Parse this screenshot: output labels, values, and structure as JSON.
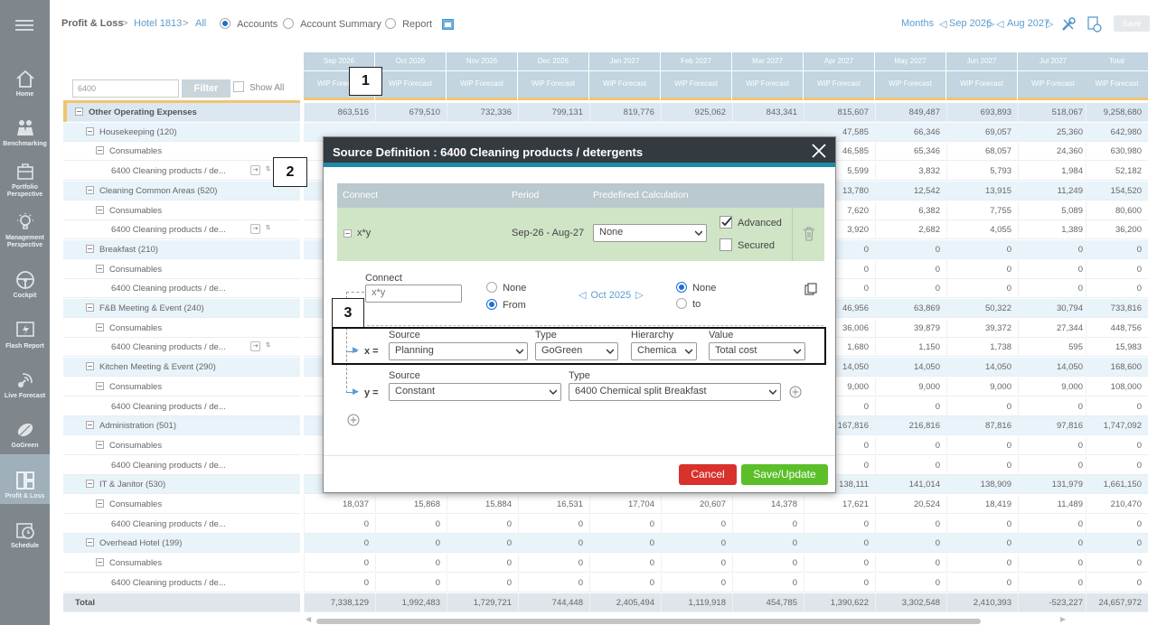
{
  "topbar": {
    "profit_loss": "Profit & Loss",
    "hotel": "Hotel 1813",
    "all": "All",
    "view_options": [
      "Accounts",
      "Account Summary",
      "Report"
    ],
    "months": "Months",
    "from_month": "Sep 2026",
    "to_month": "Aug 2027",
    "save": "Save"
  },
  "sidebar": {
    "items": [
      {
        "label": "Home",
        "icon": "home-icon"
      },
      {
        "label": "Benchmarking",
        "icon": "people-icon"
      },
      {
        "label": "Portfolio Perspective",
        "icon": "portfolio-icon"
      },
      {
        "label": "Management Perspective",
        "icon": "bulb-icon"
      },
      {
        "label": "Cockpit",
        "icon": "steering-wheel-icon"
      },
      {
        "label": "Flash Report",
        "icon": "flash-icon"
      },
      {
        "label": "Live Forecast",
        "icon": "satellite-icon"
      },
      {
        "label": "GoGreen",
        "icon": "leaf-icon"
      },
      {
        "label": "Profit & Loss",
        "icon": "grid-icon"
      },
      {
        "label": "Schedule",
        "icon": "clock-icon"
      }
    ]
  },
  "filter": {
    "value": "6400",
    "button": "Filter",
    "show_all": "Show All"
  },
  "grid": {
    "months": [
      "Sep 2026",
      "Oct 2026",
      "Nov 2026",
      "Dec 2026",
      "Jan 2027",
      "Feb 2027",
      "Mar 2027",
      "Apr 2027",
      "May 2027",
      "Jun 2027",
      "Jul 2027"
    ],
    "total_header": "Total",
    "sub_header": "WiP Forecast",
    "rows": [
      {
        "label": "Other Operating Expenses",
        "level": 0,
        "style": "sel",
        "tools": false,
        "vals": [
          "863,516",
          "679,510",
          "732,336",
          "799,131",
          "819,776",
          "925,062",
          "843,341",
          "815,607",
          "849,487",
          "693,893",
          "518,067"
        ],
        "total": "9,258,680"
      },
      {
        "label": "Housekeeping (120)",
        "level": 1,
        "style": "band",
        "tools": false,
        "vals": [
          "",
          "",
          "",
          "",
          "",
          "",
          "",
          "47,585",
          "66,346",
          "69,057",
          "25,360"
        ],
        "total": "642,980"
      },
      {
        "label": "Consumables",
        "level": 2,
        "style": "",
        "tools": false,
        "vals": [
          "",
          "",
          "",
          "",
          "",
          "",
          "",
          "46,585",
          "65,346",
          "68,057",
          "24,360"
        ],
        "total": "630,980"
      },
      {
        "label": "6400 Cleaning products / de...",
        "level": 3,
        "style": "",
        "tools": true,
        "vals": [
          "",
          "",
          "",
          "",
          "",
          "",
          "",
          "5,599",
          "3,832",
          "5,793",
          "1,984"
        ],
        "total": "52,182"
      },
      {
        "label": "Cleaning Common Areas (520)",
        "level": 1,
        "style": "band",
        "tools": false,
        "vals": [
          "",
          "",
          "",
          "",
          "",
          "",
          "",
          "13,780",
          "12,542",
          "13,915",
          "11,249"
        ],
        "total": "154,520"
      },
      {
        "label": "Consumables",
        "level": 2,
        "style": "",
        "tools": false,
        "vals": [
          "",
          "",
          "",
          "",
          "",
          "",
          "",
          "7,620",
          "6,382",
          "7,755",
          "5,089"
        ],
        "total": "80,600"
      },
      {
        "label": "6400 Cleaning products / de...",
        "level": 3,
        "style": "",
        "tools": true,
        "vals": [
          "",
          "",
          "",
          "",
          "",
          "",
          "",
          "3,920",
          "2,682",
          "4,055",
          "1,389"
        ],
        "total": "36,200"
      },
      {
        "label": "Breakfast (210)",
        "level": 1,
        "style": "band",
        "tools": false,
        "vals": [
          "",
          "",
          "",
          "",
          "",
          "",
          "",
          "0",
          "0",
          "0",
          "0"
        ],
        "total": "0"
      },
      {
        "label": "Consumables",
        "level": 2,
        "style": "",
        "tools": false,
        "vals": [
          "",
          "",
          "",
          "",
          "",
          "",
          "",
          "0",
          "0",
          "0",
          "0"
        ],
        "total": "0"
      },
      {
        "label": "6400 Cleaning products / de...",
        "level": 3,
        "style": "",
        "tools": false,
        "vals": [
          "",
          "",
          "",
          "",
          "",
          "",
          "",
          "0",
          "0",
          "0",
          "0"
        ],
        "total": "0"
      },
      {
        "label": "F&B Meeting & Event (240)",
        "level": 1,
        "style": "band",
        "tools": false,
        "vals": [
          "",
          "",
          "",
          "",
          "",
          "",
          "",
          "46,956",
          "63,869",
          "50,322",
          "30,794"
        ],
        "total": "733,816"
      },
      {
        "label": "Consumables",
        "level": 2,
        "style": "",
        "tools": false,
        "vals": [
          "",
          "",
          "",
          "",
          "",
          "",
          "",
          "36,006",
          "39,879",
          "39,372",
          "27,344"
        ],
        "total": "448,756"
      },
      {
        "label": "6400 Cleaning products / de...",
        "level": 3,
        "style": "",
        "tools": true,
        "vals": [
          "",
          "",
          "",
          "",
          "",
          "",
          "",
          "1,680",
          "1,150",
          "1,738",
          "595"
        ],
        "total": "15,983"
      },
      {
        "label": "Kitchen Meeting & Event (290)",
        "level": 1,
        "style": "band",
        "tools": false,
        "vals": [
          "",
          "",
          "",
          "",
          "",
          "",
          "",
          "14,050",
          "14,050",
          "14,050",
          "14,050"
        ],
        "total": "168,600"
      },
      {
        "label": "Consumables",
        "level": 2,
        "style": "",
        "tools": false,
        "vals": [
          "",
          "",
          "",
          "",
          "",
          "",
          "",
          "9,000",
          "9,000",
          "9,000",
          "9,000"
        ],
        "total": "108,000"
      },
      {
        "label": "6400 Cleaning products / de...",
        "level": 3,
        "style": "",
        "tools": false,
        "vals": [
          "",
          "",
          "",
          "",
          "",
          "",
          "",
          "0",
          "0",
          "0",
          "0"
        ],
        "total": "0"
      },
      {
        "label": "Administration (501)",
        "level": 1,
        "style": "band",
        "tools": false,
        "vals": [
          "",
          "",
          "",
          "",
          "",
          "",
          "",
          "167,816",
          "216,816",
          "87,816",
          "97,816"
        ],
        "total": "1,747,092"
      },
      {
        "label": "Consumables",
        "level": 2,
        "style": "",
        "tools": false,
        "vals": [
          "",
          "",
          "",
          "",
          "",
          "",
          "",
          "0",
          "0",
          "0",
          "0"
        ],
        "total": "0"
      },
      {
        "label": "6400 Cleaning products / de...",
        "level": 3,
        "style": "",
        "tools": false,
        "vals": [
          "",
          "",
          "",
          "",
          "",
          "",
          "",
          "0",
          "0",
          "0",
          "0"
        ],
        "total": "0"
      },
      {
        "label": "IT & Janitor (530)",
        "level": 1,
        "style": "band",
        "tools": false,
        "vals": [
          "",
          "",
          "",
          "",
          "",
          "",
          "",
          "138,111",
          "141,014",
          "138,909",
          "131,979"
        ],
        "total": "1,661,150"
      },
      {
        "label": "Consumables",
        "level": 2,
        "style": "",
        "tools": false,
        "vals": [
          "18,037",
          "15,868",
          "15,884",
          "16,531",
          "17,704",
          "20,607",
          "14,378",
          "17,621",
          "20,524",
          "18,419",
          "11,489"
        ],
        "total": "210,470"
      },
      {
        "label": "6400 Cleaning products / de...",
        "level": 3,
        "style": "",
        "tools": false,
        "vals": [
          "0",
          "0",
          "0",
          "0",
          "0",
          "0",
          "0",
          "0",
          "0",
          "0",
          "0"
        ],
        "total": "0"
      },
      {
        "label": "Overhead Hotel (199)",
        "level": 1,
        "style": "band",
        "tools": false,
        "vals": [
          "0",
          "0",
          "0",
          "0",
          "0",
          "0",
          "0",
          "0",
          "0",
          "0",
          "0"
        ],
        "total": "0"
      },
      {
        "label": "Consumables",
        "level": 2,
        "style": "",
        "tools": false,
        "vals": [
          "0",
          "0",
          "0",
          "0",
          "0",
          "0",
          "0",
          "0",
          "0",
          "0",
          "0"
        ],
        "total": "0"
      },
      {
        "label": "6400 Cleaning products / de...",
        "level": 3,
        "style": "",
        "tools": false,
        "vals": [
          "0",
          "0",
          "0",
          "0",
          "0",
          "0",
          "0",
          "0",
          "0",
          "0",
          "0"
        ],
        "total": "0"
      },
      {
        "label": "Total",
        "level": 0,
        "style": "total",
        "tools": false,
        "vals": [
          "7,338,129",
          "1,992,483",
          "1,729,721",
          "744,448",
          "2,405,494",
          "1,119,918",
          "454,785",
          "1,390,622",
          "3,302,548",
          "2,410,393",
          "-523,227"
        ],
        "total": "24,657,972"
      }
    ]
  },
  "modal": {
    "title": "Source Definition : 6400 Cleaning products / detergents",
    "headers": {
      "connect": "Connect",
      "period": "Period",
      "predefined": "Predefined Calculation"
    },
    "formula": "x*y",
    "period": "Sep-26 - Aug-27",
    "predefined_value": "None",
    "advanced": "Advanced",
    "secured": "Secured",
    "connect_label": "Connect",
    "connect_value": "x*y",
    "start_none": "None",
    "start_from": "From",
    "month": "Oct 2025",
    "end_none": "None",
    "end_to": "to",
    "x_label": "x =",
    "y_label": "y =",
    "source_label": "Source",
    "type_label": "Type",
    "hierarchy_label": "Hierarchy",
    "value_label": "Value",
    "x_source": "Planning",
    "x_type": "GoGreen",
    "x_hierarchy": "Chemica",
    "x_value": "Total cost",
    "y_source": "Constant",
    "y_type": "6400 Chemical split Breakfast",
    "cancel": "Cancel",
    "save": "Save/Update"
  },
  "annotations": [
    "1",
    "2",
    "3"
  ],
  "colors": {
    "accent": "#1f8aa8",
    "cancel": "#d9312b",
    "save": "#5cbf2a",
    "header": "#c2d5e0"
  }
}
